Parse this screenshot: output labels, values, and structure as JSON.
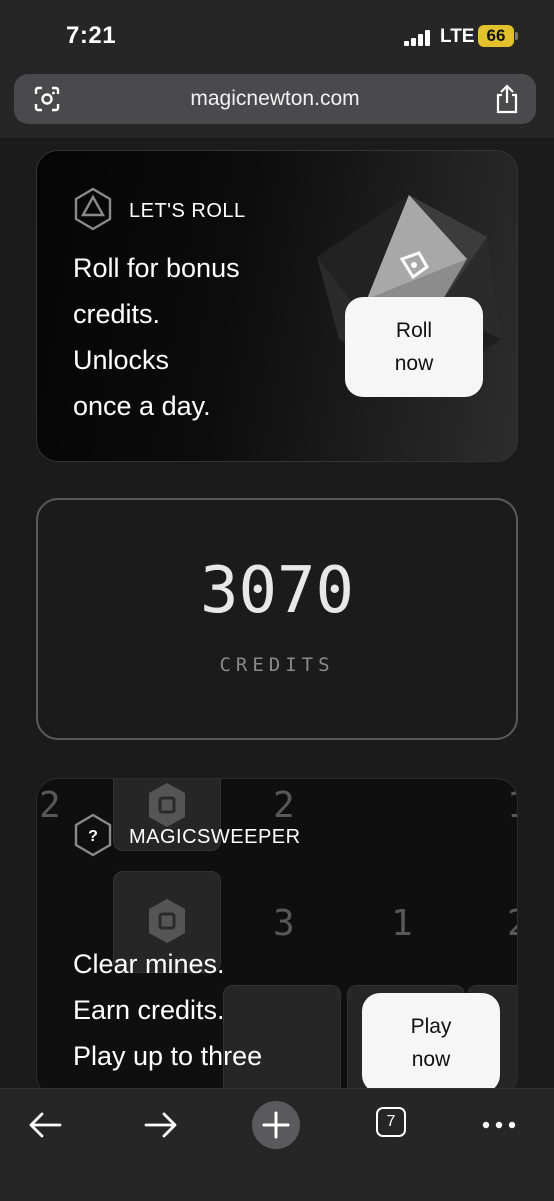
{
  "status": {
    "time": "7:21",
    "network": "LTE",
    "battery": "66"
  },
  "browser": {
    "url": "magicnewton.com",
    "tab_count": "7"
  },
  "roll_card": {
    "title": "LET'S ROLL",
    "lines": [
      "Roll for bonus",
      "credits.",
      "Unlocks",
      "once a day."
    ],
    "button_line1": "Roll",
    "button_line2": "now"
  },
  "credits_card": {
    "value": "3070",
    "label": "CREDITS"
  },
  "sweeper_card": {
    "title": "MAGICSWEEPER",
    "lines": [
      "Clear mines.",
      "Earn credits.",
      "Play up to three"
    ],
    "button_line1": "Play",
    "button_line2": "now",
    "grid_numbers": [
      "2",
      "2",
      "1",
      "3",
      "1",
      "2"
    ]
  }
}
